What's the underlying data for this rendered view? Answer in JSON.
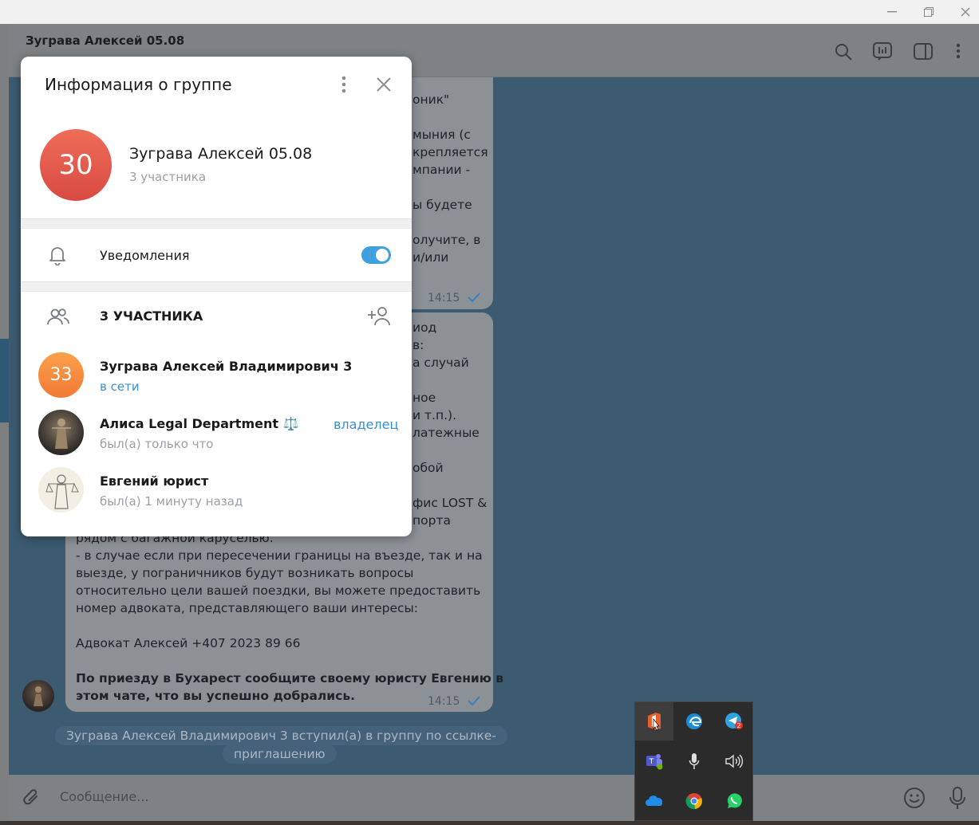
{
  "window": {
    "minimize_icon": "minimize-icon",
    "restore_icon": "restore-icon",
    "close_icon": "close-icon"
  },
  "chat": {
    "title": "Зугрaва Алексей 05.08",
    "header_icons": [
      "search-icon",
      "polls-icon",
      "sidebar-toggle-icon",
      "more-vert-icon"
    ],
    "bubble1": {
      "lines": [
        "оник\"",
        "",
        "мыния (с",
        "крепляется",
        "мпании -",
        "",
        "ы будете",
        "",
        "олучите, в",
        "и/или"
      ],
      "time": "14:15"
    },
    "bubble2": {
      "lines_partial": [
        "иод",
        "в:",
        "а случай",
        "",
        "ное",
        "и т.п.).",
        "латежные",
        "",
        "обой",
        "",
        "фис LOST &",
        "порта"
      ],
      "lines_full": [
        "рядом с багажной каруселью.",
        "- в случае если при пересечении границы на въезде, так и на",
        "выезде, у пограничников будут возникать вопросы",
        "относительно цели вашей поездки, вы можете предоставить",
        "номер адвоката, представляющего ваши интересы:",
        "",
        "Адвокат Алексей +407 2023 89 66",
        ""
      ],
      "bold_lines": [
        "По приезду в Бухарест сообщите своему юристу Евгению в",
        "этом чате, что вы успешно добрались."
      ],
      "time": "14:15"
    },
    "system_message": [
      "Зугрaва Алексей Владимирович 3 вступил(а) в группу по ссылке-",
      "приглашению"
    ],
    "composer_placeholder": "Сообщение..."
  },
  "modal": {
    "title": "Информация о группе",
    "group": {
      "avatar_text": "30",
      "name": "Зугрaва Алексей 05.08",
      "count": "3 участника",
      "avatar_color": "#e4574b"
    },
    "notifications": {
      "label": "Уведомления",
      "enabled": true
    },
    "members_header": "3 УЧАСТНИКА",
    "members": [
      {
        "avatar_text": "33",
        "name": "Зугрaва Алексей Владимирович 3",
        "status": "в сети",
        "avatar_color": "#f5883a"
      },
      {
        "name": "Алиса Legal Department ⚖️",
        "status": "был(а) только что",
        "role": "владелец"
      },
      {
        "name": "Евгений юрист",
        "status": "был(а) 1 минуту назад"
      }
    ]
  },
  "tray": {
    "icons": [
      "office-icon",
      "edge-icon",
      "telegram-icon",
      "teams-icon",
      "microphone-icon",
      "volume-icon",
      "onedrive-icon",
      "chrome-icon",
      "whatsapp-icon"
    ],
    "telegram_badge": "2"
  }
}
